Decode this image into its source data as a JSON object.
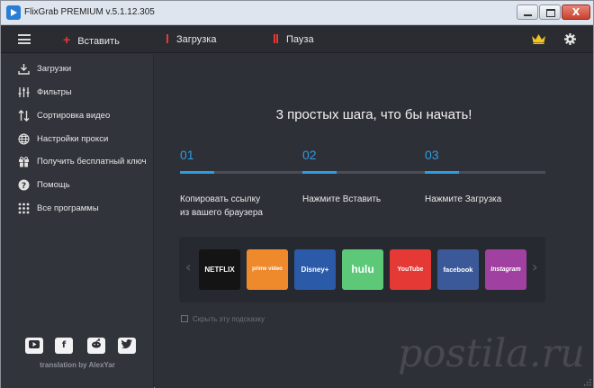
{
  "window": {
    "title": "FlixGrab PREMIUM  v.5.1.12.305",
    "close_glyph": "X"
  },
  "toolbar": {
    "paste_label": "Вставить",
    "download_label": "Загрузка",
    "pause_label": "Пауза",
    "accent_color": "#e53935"
  },
  "sidebar": {
    "items": [
      {
        "label": "Загрузки",
        "icon": "download-icon"
      },
      {
        "label": "Фильтры",
        "icon": "filter-sliders-icon"
      },
      {
        "label": "Сортировка видео",
        "icon": "sort-icon"
      },
      {
        "label": "Настройки прокси",
        "icon": "globe-icon"
      },
      {
        "label": "Получить бесплатный ключ",
        "icon": "gift-icon"
      },
      {
        "label": "Помощь",
        "icon": "help-icon"
      },
      {
        "label": "Все программы",
        "icon": "grid-icon"
      }
    ],
    "social": [
      "youtube-icon",
      "facebook-icon",
      "reddit-icon",
      "twitter-icon"
    ],
    "credit": "translation by AlexYar"
  },
  "main": {
    "heading": "3 простых шага, что бы начать!",
    "steps": [
      {
        "num": "01",
        "text_line1": "Копировать ссылку",
        "text_line2": "из вашего браузера"
      },
      {
        "num": "02",
        "text_line1": "Нажмите Вставить",
        "text_line2": ""
      },
      {
        "num": "03",
        "text_line1": "Нажмите Загрузка",
        "text_line2": ""
      }
    ],
    "step_progress": 0.28,
    "services": [
      {
        "name": "NETFLIX",
        "color": "#141414"
      },
      {
        "name": "prime video",
        "color": "#ee8a2c"
      },
      {
        "name": "Disney+",
        "color": "#2a5aa8"
      },
      {
        "name": "hulu",
        "color": "#5cc878"
      },
      {
        "name": "YouTube",
        "color": "#e53935"
      },
      {
        "name": "facebook",
        "color": "#3b5998"
      },
      {
        "name": "Instagram",
        "color": "#a040a0"
      }
    ],
    "hint_label": "Скрыть эту подсказку",
    "accent_color": "#2f9be0"
  },
  "watermark": "postila.ru"
}
